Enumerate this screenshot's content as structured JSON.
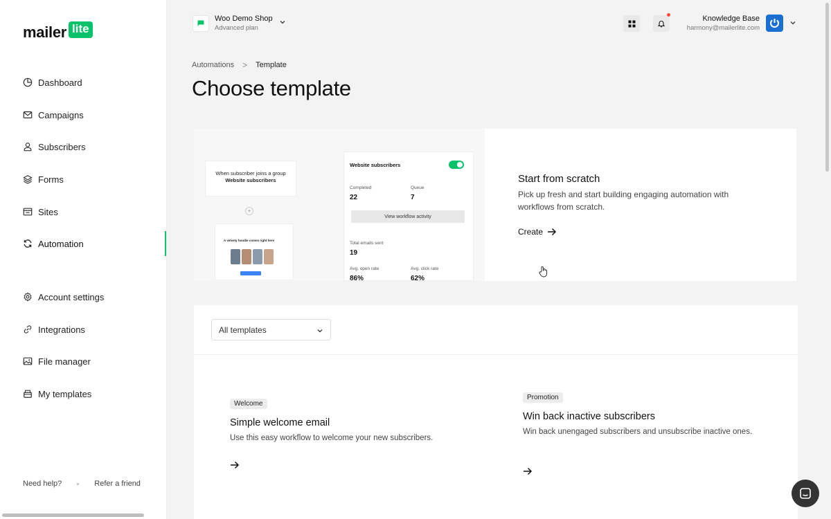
{
  "logo": {
    "word": "mailer",
    "badge": "lite"
  },
  "sidebar": {
    "items": [
      {
        "label": "Dashboard",
        "icon": "dashboard-icon"
      },
      {
        "label": "Campaigns",
        "icon": "mail-icon"
      },
      {
        "label": "Subscribers",
        "icon": "user-icon"
      },
      {
        "label": "Forms",
        "icon": "layers-icon"
      },
      {
        "label": "Sites",
        "icon": "browser-icon"
      },
      {
        "label": "Automation",
        "icon": "refresh-icon",
        "active": true
      },
      {
        "label": "Account settings",
        "icon": "gear-icon"
      },
      {
        "label": "Integrations",
        "icon": "link-icon"
      },
      {
        "label": "File manager",
        "icon": "image-icon"
      },
      {
        "label": "My templates",
        "icon": "template-icon"
      }
    ],
    "footer": {
      "help": "Need help?",
      "refer": "Refer a friend"
    }
  },
  "topbar": {
    "shop_name": "Woo Demo Shop",
    "shop_plan": "Advanced plan",
    "account_name": "Knowledge Base",
    "account_email": "harmony@mailerlite.com"
  },
  "breadcrumb": {
    "parent": "Automations",
    "separator": ">",
    "current": "Template"
  },
  "page_title": "Choose template",
  "scratch": {
    "title": "Start from scratch",
    "description": "Pick up fresh and start building engaging automation with workflows from scratch.",
    "cta": "Create",
    "preview": {
      "trigger_text": "When subscriber joins a group",
      "trigger_group": "Website subscribers",
      "email_headline": "A velvety hoodie comes right here",
      "stats_title": "Website subscribers",
      "completed_label": "Completed",
      "completed_value": "22",
      "queue_label": "Queue",
      "queue_value": "7",
      "view_button": "View workflow activity",
      "total_label": "Total emails sent",
      "total_value": "19",
      "open_label": "Avg. open rate",
      "open_value": "86%",
      "click_label": "Avg. click rate",
      "click_value": "62%"
    }
  },
  "filter": {
    "selected": "All templates"
  },
  "templates": [
    {
      "badge": "Welcome",
      "name": "Simple welcome email",
      "description": "Use this easy workflow to welcome your new subscribers."
    },
    {
      "badge": "Promotion",
      "name": "Win back inactive subscribers",
      "description": "Win back unengaged subscribers and unsubscribe inactive ones."
    }
  ],
  "colors": {
    "brand": "#09c269",
    "notification": "#ff4a3d",
    "avatar": "#1b6fd1"
  }
}
